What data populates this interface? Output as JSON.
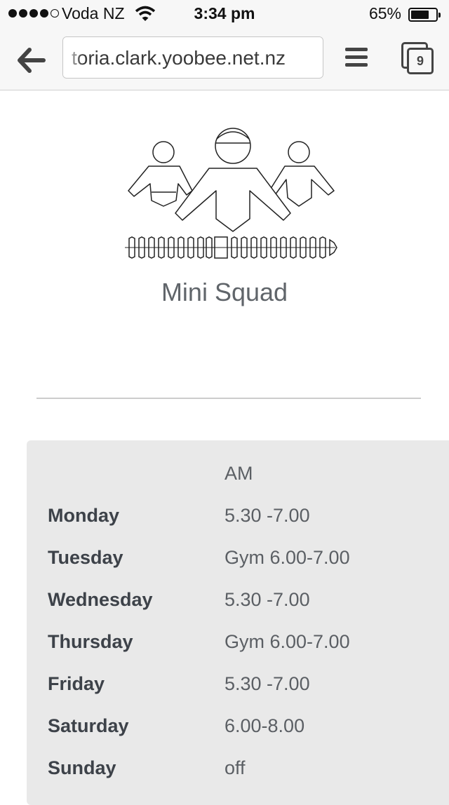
{
  "status": {
    "carrier": "Voda NZ",
    "time": "3:34 pm",
    "battery": "65%",
    "battery_level": 0.65,
    "signal_bars": 4
  },
  "browser": {
    "url": "toria.clark.yoobee.net.nz",
    "tab_count": "9",
    "icons": [
      "back-arrow-icon",
      "menu-icon",
      "tabs-icon",
      "wifi-icon"
    ]
  },
  "page": {
    "title": "Mini Squad",
    "logo": "swimmers-lane-rope-icon"
  },
  "schedule": {
    "column_header": "AM",
    "rows": [
      {
        "day": "Monday",
        "time": "5.30 -7.00"
      },
      {
        "day": "Tuesday",
        "time": "Gym 6.00-7.00"
      },
      {
        "day": "Wednesday",
        "time": "5.30 -7.00"
      },
      {
        "day": "Thursday",
        "time": "Gym 6.00-7.00"
      },
      {
        "day": "Friday",
        "time": "5.30 -7.00"
      },
      {
        "day": "Saturday",
        "time": "6.00-8.00"
      },
      {
        "day": "Sunday",
        "time": "off"
      }
    ]
  },
  "colors": {
    "panel_bg": "#e9e9e9",
    "text_dark": "#3d4249",
    "text_muted": "#5b5f64"
  }
}
